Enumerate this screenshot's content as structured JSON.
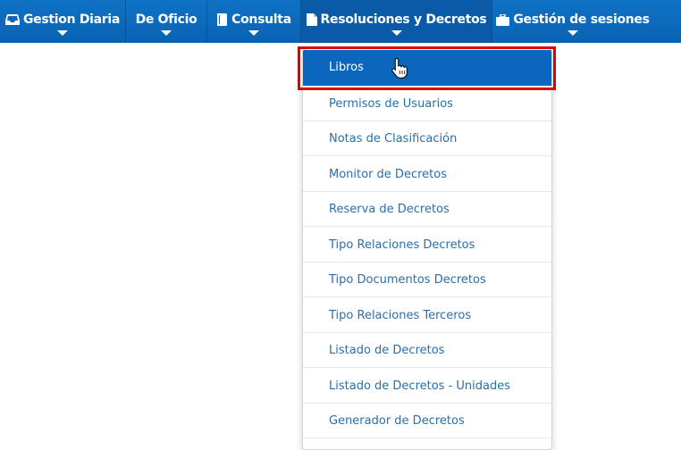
{
  "nav": {
    "items": [
      {
        "label": "Gestion Diaria",
        "icon": "inbox-icon"
      },
      {
        "label": "De Oficio",
        "icon": ""
      },
      {
        "label": "Consulta",
        "icon": "book-icon"
      },
      {
        "label": "Resoluciones y Decretos",
        "icon": "document-icon"
      },
      {
        "label": "Gestión de sesiones",
        "icon": "briefcase-icon"
      }
    ],
    "active": "Resoluciones y Decretos"
  },
  "dropdown": {
    "items": [
      "Libros",
      "Permisos de Usuarios",
      "Notas de Clasificación",
      "Monitor de Decretos",
      "Reserva de Decretos",
      "Tipo Relaciones Decretos",
      "Tipo Documentos Decretos",
      "Tipo Relaciones Terceros",
      "Listado de Decretos",
      "Listado de Decretos - Unidades",
      "Generador de Decretos"
    ],
    "selected": "Libros"
  },
  "colors": {
    "navbar": "#0a66b8",
    "menu_text": "#2a6fab",
    "selected_bg": "#0d66bd",
    "highlight_border": "#e00000"
  }
}
